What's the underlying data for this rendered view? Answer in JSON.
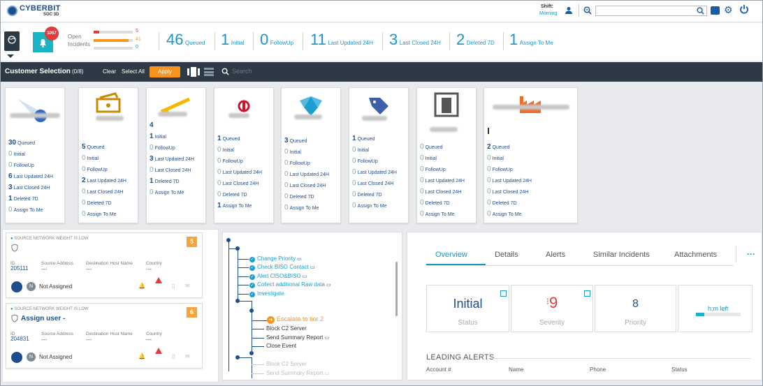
{
  "header": {
    "brand": "CYBERBIT",
    "sub": "SOC 3D",
    "shift_label": "Shift:",
    "shift_value": "Morning",
    "search_placeholder": ""
  },
  "stats": {
    "bell_count": "1057",
    "open_label_1": "Open",
    "open_label_2": "Incidents",
    "bars": [
      {
        "value": "5",
        "color": "#e13b3b",
        "fill": 0.15
      },
      {
        "value": "41",
        "color": "#f7941d",
        "fill": 0.9
      },
      {
        "value": "0",
        "color": "#1a95c9",
        "fill": 0.0
      }
    ],
    "items": [
      {
        "n": "46",
        "label": "Queued"
      },
      {
        "n": "1",
        "label": "Initial"
      },
      {
        "n": "0",
        "label": "FollowUp"
      },
      {
        "n": "11",
        "label": "Last Updated 24H"
      },
      {
        "n": "3",
        "label": "Last Closed 24H"
      },
      {
        "n": "2",
        "label": "Deleted 7D"
      },
      {
        "n": "1",
        "label": "Assign To Me"
      }
    ]
  },
  "selection": {
    "title": "Customer Selection",
    "count": "(0/8)",
    "clear": "Clear",
    "select_all": "Select All",
    "apply": "Apply",
    "search": "Search"
  },
  "cards": [
    {
      "icon": "comet-icon",
      "rows": [
        [
          "30",
          "Queued"
        ],
        [
          "0",
          "Initial"
        ],
        [
          "0",
          "FollowUp"
        ],
        [
          "6",
          "Last Updated 24H"
        ],
        [
          "3",
          "Last Closed 24H"
        ],
        [
          "1",
          "Deleted 7D"
        ],
        [
          "0",
          "Assign To Me"
        ]
      ]
    },
    {
      "icon": "money-icon",
      "rows": [
        [
          "5",
          "Queued"
        ],
        [
          "0",
          "Initial"
        ],
        [
          "0",
          "FollowUp"
        ],
        [
          "2",
          "Last Updated 24H"
        ],
        [
          "0",
          "Last Closed 24H"
        ],
        [
          "0",
          "Deleted 7D"
        ],
        [
          "0",
          "Assign To Me"
        ]
      ]
    },
    {
      "icon": "barrier-icon",
      "rows": [
        [
          "4",
          ""
        ],
        [
          "1",
          "Initial"
        ],
        [
          "0",
          "FollowUp"
        ],
        [
          "3",
          "Last Updated 24H"
        ],
        [
          "0",
          "Last Closed 24H"
        ],
        [
          "1",
          "Deleted 7D"
        ],
        [
          "0",
          "Assign To Me"
        ]
      ]
    },
    {
      "icon": "bank-logo-icon",
      "rows": [
        [
          "1",
          "Queued"
        ],
        [
          "0",
          "Initial"
        ],
        [
          "0",
          "FollowUp"
        ],
        [
          "0",
          "Last Updated 24H"
        ],
        [
          "0",
          "Last Closed 24H"
        ],
        [
          "0",
          "Deleted 7D"
        ],
        [
          "1",
          "Assign To Me"
        ]
      ]
    },
    {
      "icon": "eagle-logo-icon",
      "rows": [
        [
          "3",
          "Queued"
        ],
        [
          "0",
          "Initial"
        ],
        [
          "0",
          "FollowUp"
        ],
        [
          "0",
          "Last Updated 24H"
        ],
        [
          "0",
          "Last Closed 24H"
        ],
        [
          "0",
          "Deleted 7D"
        ],
        [
          "0",
          "Assign To Me"
        ]
      ]
    },
    {
      "icon": "tag-icon",
      "rows": [
        [
          "1",
          "Queued"
        ],
        [
          "0",
          "Initial"
        ],
        [
          "0",
          "FollowUp"
        ],
        [
          "0",
          "Last Updated 24H"
        ],
        [
          "0",
          "Last Closed 24H"
        ],
        [
          "0",
          "Deleted 7D"
        ],
        [
          "0",
          "Assign To Me"
        ]
      ]
    },
    {
      "icon": "building-icon",
      "rows": [
        [
          "0",
          "Queued"
        ],
        [
          "0",
          "Initial"
        ],
        [
          "0",
          "FollowUp"
        ],
        [
          "0",
          "Last Updated 24H"
        ],
        [
          "0",
          "Last Closed 24H"
        ],
        [
          "0",
          "Deleted 7D"
        ],
        [
          "0",
          "Assign To Me"
        ]
      ]
    },
    {
      "icon": "factory-icon",
      "rows": [
        [
          "2",
          "Queued"
        ],
        [
          "0",
          "Initial"
        ],
        [
          "0",
          "FollowUp"
        ],
        [
          "0",
          "Last Updated 24H"
        ],
        [
          "0",
          "Last Closed 24H"
        ],
        [
          "0",
          "Deleted 7D"
        ],
        [
          "0",
          "Assign To Me"
        ]
      ]
    }
  ],
  "incidents": [
    {
      "header": "SOURCE NETWORK WEIGHT IS LOW",
      "number": "5",
      "title": "",
      "id_label": "ID",
      "id": "205111",
      "src_label": "Source Address",
      "src": "---",
      "dst_label": "Destination Host Name",
      "dst": "---",
      "country_label": "Country",
      "country": "---",
      "assignee_initial": "N",
      "assignee": "Not Assigned"
    },
    {
      "header": "SOURCE NETWORK WEIGHT IS LOW",
      "number": "6",
      "title": "Assign user -",
      "id_label": "ID",
      "id": "204831",
      "src_label": "Source Address",
      "src": "---",
      "dst_label": "Destination Host Name",
      "dst": "---",
      "country_label": "Country",
      "country": "---",
      "assignee_initial": "N",
      "assignee": "Not Assigned"
    }
  ],
  "workflow": {
    "done": [
      "Change Priority",
      "Check BISO Contact",
      "Alert CISO&BISO",
      "Collect additional Raw data",
      "Investigate"
    ],
    "escalate": "Escalate to tier 2",
    "next": [
      "Block C2 Server",
      "Send Summary Report",
      "Close Event"
    ],
    "dim": [
      "Block C2 Server",
      "Send Summary Report"
    ]
  },
  "details": {
    "tabs": [
      "Overview",
      "Details",
      "Alerts",
      "Similar Incidents",
      "Attachments"
    ],
    "more": "···",
    "status_value": "Initial",
    "status_label": "Status",
    "severity_value": "9",
    "severity_label": "Severity",
    "priority_value": "8",
    "priority_label": "Priority",
    "hm_label": "h:m left",
    "leading_alerts": "LEADING ALERTS",
    "cols": [
      "Account #",
      "Name",
      "Phone",
      "Status"
    ]
  },
  "colors": {
    "accent": "#1a95c9",
    "dark": "#2d3a45",
    "orange": "#f7941d",
    "red": "#e13b3b"
  }
}
